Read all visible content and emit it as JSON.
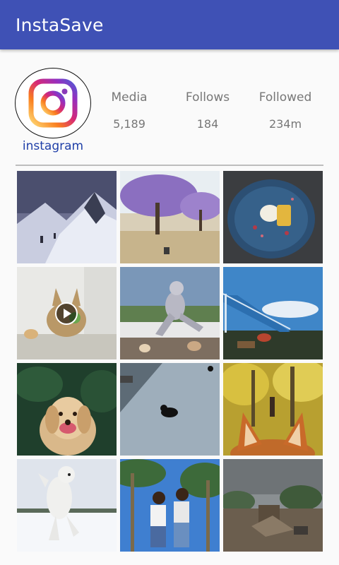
{
  "app": {
    "title": "InstaSave"
  },
  "profile": {
    "username": "instagram",
    "avatar_icon": "instagram-logo-icon",
    "stats": [
      {
        "label": "Media",
        "value": "5,189"
      },
      {
        "label": "Follows",
        "value": "184"
      },
      {
        "label": "Followed",
        "value": "234m"
      }
    ]
  },
  "media_grid": [
    {
      "subject": "snowy mountain ridge with hikers",
      "is_video": false
    },
    {
      "subject": "purple jacaranda tree in park",
      "is_video": false
    },
    {
      "subject": "plated dessert on blue plate",
      "is_video": false
    },
    {
      "subject": "dog behind glass table",
      "is_video": true
    },
    {
      "subject": "person in wolf costume running",
      "is_video": false
    },
    {
      "subject": "blue staircase and sky",
      "is_video": false
    },
    {
      "subject": "smiling golden retriever",
      "is_video": false
    },
    {
      "subject": "black cat on concrete",
      "is_video": false
    },
    {
      "subject": "fox ears in autumn forest",
      "is_video": false
    },
    {
      "subject": "white dog jumping in snow",
      "is_video": false
    },
    {
      "subject": "two girls under palm trees",
      "is_video": false
    },
    {
      "subject": "storm damaged landscape",
      "is_video": false
    }
  ],
  "colors": {
    "appbar": "#3f51b5",
    "username": "#1f3fa8",
    "stat_text": "#777777"
  }
}
